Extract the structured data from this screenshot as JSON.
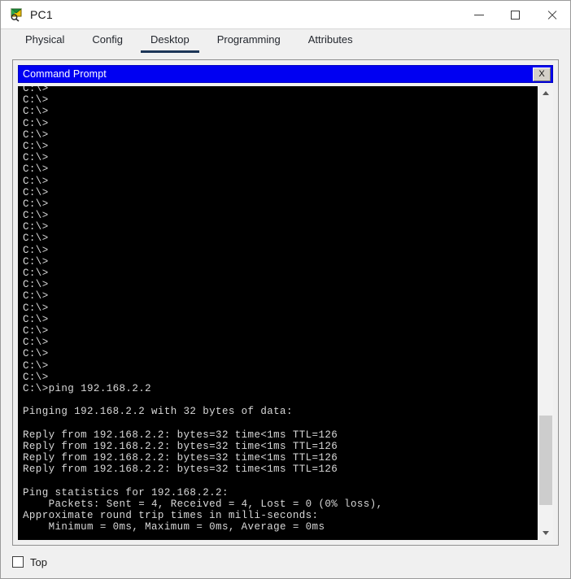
{
  "window": {
    "title": "PC1",
    "icon": "pc-device-icon",
    "controls": {
      "minimize": "minimize-icon",
      "maximize": "maximize-icon",
      "close": "close-icon"
    }
  },
  "tabs": [
    {
      "label": "Physical",
      "active": false
    },
    {
      "label": "Config",
      "active": false
    },
    {
      "label": "Desktop",
      "active": true
    },
    {
      "label": "Programming",
      "active": false
    },
    {
      "label": "Attributes",
      "active": false
    }
  ],
  "app": {
    "title": "Command Prompt",
    "close_label": "X",
    "titlebar_color": "#0000f2"
  },
  "terminal": {
    "background": "#000000",
    "foreground": "#d8d8d8",
    "lines": [
      "C:\\>",
      "C:\\>",
      "C:\\>",
      "C:\\>",
      "C:\\>",
      "C:\\>",
      "C:\\>",
      "C:\\>",
      "C:\\>",
      "C:\\>",
      "C:\\>",
      "C:\\>",
      "C:\\>",
      "C:\\>",
      "C:\\>",
      "C:\\>",
      "C:\\>",
      "C:\\>",
      "C:\\>",
      "C:\\>",
      "C:\\>",
      "C:\\>",
      "C:\\>",
      "C:\\>",
      "C:\\>",
      "C:\\>",
      "C:\\>ping 192.168.2.2",
      "",
      "Pinging 192.168.2.2 with 32 bytes of data:",
      "",
      "Reply from 192.168.2.2: bytes=32 time<1ms TTL=126",
      "Reply from 192.168.2.2: bytes=32 time<1ms TTL=126",
      "Reply from 192.168.2.2: bytes=32 time<1ms TTL=126",
      "Reply from 192.168.2.2: bytes=32 time<1ms TTL=126",
      "",
      "Ping statistics for 192.168.2.2:",
      "    Packets: Sent = 4, Received = 4, Lost = 0 (0% loss),",
      "Approximate round trip times in milli-seconds:",
      "    Minimum = 0ms, Maximum = 0ms, Average = 0ms",
      ""
    ],
    "prompt_line": "C:\\>"
  },
  "scrollbar": {
    "up_icon": "chevron-up-icon",
    "down_icon": "chevron-down-icon",
    "thumb_top_percent": 74,
    "thumb_height_percent": 21
  },
  "footer": {
    "top_checkbox_label": "Top",
    "top_checkbox_checked": false
  }
}
